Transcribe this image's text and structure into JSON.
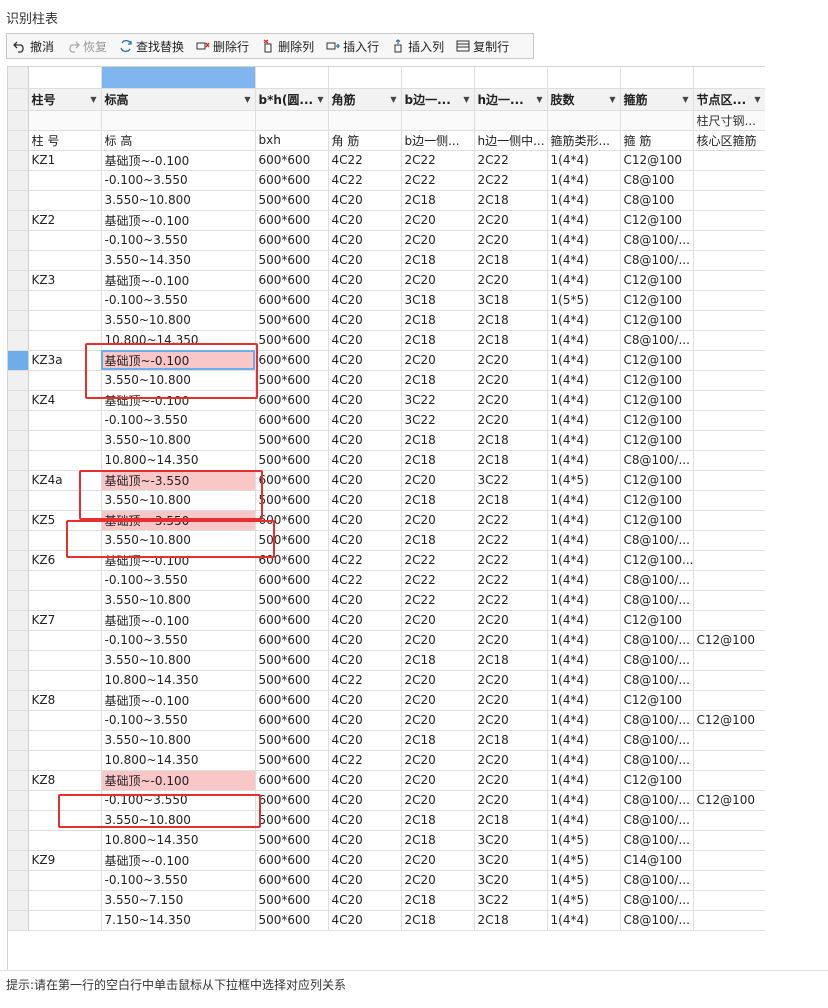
{
  "window": {
    "title": "识别柱表"
  },
  "toolbar": {
    "undo": "撤消",
    "redo": "恢复",
    "find_replace": "查找替换",
    "delete_row": "删除行",
    "delete_col": "删除列",
    "insert_row": "插入行",
    "insert_col": "插入列",
    "copy_row": "复制行"
  },
  "columns": {
    "headers": [
      "柱号",
      "标高",
      "b*h(圆...",
      "角筋",
      "b边一...",
      "h边一...",
      "肢数",
      "箍筋",
      "节点区..."
    ],
    "sub_header": [
      "",
      "",
      "",
      "",
      "",
      "",
      "",
      "",
      "柱尺寸钢..."
    ],
    "source_header": [
      "柱 号",
      "标 高",
      "bxh",
      "角 筋",
      "b边一侧...",
      "h边一侧中...",
      "箍筋类形...",
      "箍 筋",
      "核心区箍筋"
    ]
  },
  "rows": [
    [
      "KZ1",
      "基础顶~-0.100",
      "600*600",
      "4C22",
      "2C22",
      "2C22",
      "1(4*4)",
      "C12@100",
      ""
    ],
    [
      "",
      "-0.100~3.550",
      "600*600",
      "4C22",
      "2C22",
      "2C22",
      "1(4*4)",
      "C8@100",
      ""
    ],
    [
      "",
      "3.550~10.800",
      "500*600",
      "4C20",
      "2C18",
      "2C18",
      "1(4*4)",
      "C8@100",
      ""
    ],
    [
      "KZ2",
      "基础顶~-0.100",
      "600*600",
      "4C20",
      "2C20",
      "2C20",
      "1(4*4)",
      "C12@100",
      ""
    ],
    [
      "",
      "-0.100~3.550",
      "600*600",
      "4C20",
      "2C20",
      "2C20",
      "1(4*4)",
      "C8@100/...",
      ""
    ],
    [
      "",
      "3.550~14.350",
      "500*600",
      "4C20",
      "2C18",
      "2C18",
      "1(4*4)",
      "C8@100/...",
      ""
    ],
    [
      "KZ3",
      "基础顶~-0.100",
      "600*600",
      "4C20",
      "2C20",
      "2C20",
      "1(4*4)",
      "C12@100",
      ""
    ],
    [
      "",
      "-0.100~3.550",
      "600*600",
      "4C20",
      "3C18",
      "3C18",
      "1(5*5)",
      "C12@100",
      ""
    ],
    [
      "",
      "3.550~10.800",
      "500*600",
      "4C20",
      "2C18",
      "2C18",
      "1(4*4)",
      "C12@100",
      ""
    ],
    [
      "",
      "10.800~14.350",
      "500*600",
      "4C20",
      "2C18",
      "2C18",
      "1(4*4)",
      "C8@100/...",
      ""
    ],
    [
      "KZ3a",
      "基础顶~-0.100",
      "600*600",
      "4C20",
      "2C20",
      "2C20",
      "1(4*4)",
      "C12@100",
      ""
    ],
    [
      "",
      "3.550~10.800",
      "500*600",
      "4C20",
      "2C18",
      "2C20",
      "1(4*4)",
      "C12@100",
      ""
    ],
    [
      "KZ4",
      "基础顶~-0.100",
      "600*600",
      "4C20",
      "3C22",
      "2C20",
      "1(4*4)",
      "C12@100",
      ""
    ],
    [
      "",
      "-0.100~3.550",
      "600*600",
      "4C20",
      "3C22",
      "2C20",
      "1(4*4)",
      "C12@100",
      ""
    ],
    [
      "",
      "3.550~10.800",
      "500*600",
      "4C20",
      "2C18",
      "2C18",
      "1(4*4)",
      "C12@100",
      ""
    ],
    [
      "",
      "10.800~14.350",
      "500*600",
      "4C20",
      "2C18",
      "2C18",
      "1(4*4)",
      "C8@100/...",
      ""
    ],
    [
      "KZ4a",
      "基础顶~-3.550",
      "600*600",
      "4C20",
      "2C20",
      "3C22",
      "1(4*5)",
      "C12@100",
      ""
    ],
    [
      "",
      "3.550~10.800",
      "500*600",
      "4C20",
      "2C18",
      "2C18",
      "1(4*4)",
      "C12@100",
      ""
    ],
    [
      "KZ5",
      "基础顶~-3.550",
      "600*600",
      "4C20",
      "2C20",
      "2C22",
      "1(4*4)",
      "C12@100",
      ""
    ],
    [
      "",
      "3.550~10.800",
      "500*600",
      "4C20",
      "2C18",
      "2C22",
      "1(4*4)",
      "C8@100/...",
      ""
    ],
    [
      "KZ6",
      "基础顶~-0.100",
      "600*600",
      "4C22",
      "2C22",
      "2C22",
      "1(4*4)",
      "C12@100...",
      ""
    ],
    [
      "",
      "-0.100~3.550",
      "600*600",
      "4C22",
      "2C22",
      "2C22",
      "1(4*4)",
      "C8@100/...",
      ""
    ],
    [
      "",
      "3.550~10.800",
      "500*600",
      "4C20",
      "2C22",
      "2C22",
      "1(4*4)",
      "C8@100/...",
      ""
    ],
    [
      "KZ7",
      "基础顶~-0.100",
      "600*600",
      "4C20",
      "2C20",
      "2C20",
      "1(4*4)",
      "C12@100",
      ""
    ],
    [
      "",
      "-0.100~3.550",
      "600*600",
      "4C20",
      "2C20",
      "2C20",
      "1(4*4)",
      "C8@100/...",
      "C12@100"
    ],
    [
      "",
      "3.550~10.800",
      "500*600",
      "4C20",
      "2C18",
      "2C18",
      "1(4*4)",
      "C8@100/...",
      ""
    ],
    [
      "",
      "10.800~14.350",
      "500*600",
      "4C22",
      "2C20",
      "2C20",
      "1(4*4)",
      "C8@100/...",
      ""
    ],
    [
      "KZ8",
      "基础顶~-0.100",
      "600*600",
      "4C20",
      "2C20",
      "2C20",
      "1(4*4)",
      "C12@100",
      ""
    ],
    [
      "",
      "-0.100~3.550",
      "600*600",
      "4C20",
      "2C20",
      "2C20",
      "1(4*4)",
      "C8@100/...",
      "C12@100"
    ],
    [
      "",
      "3.550~10.800",
      "500*600",
      "4C20",
      "2C18",
      "2C18",
      "1(4*4)",
      "C8@100/...",
      ""
    ],
    [
      "",
      "10.800~14.350",
      "500*600",
      "4C22",
      "2C20",
      "2C20",
      "1(4*4)",
      "C8@100/...",
      ""
    ],
    [
      "KZ8",
      "基础顶~-0.100",
      "600*600",
      "4C20",
      "2C20",
      "2C20",
      "1(4*4)",
      "C12@100",
      ""
    ],
    [
      "",
      "-0.100~3.550",
      "600*600",
      "4C20",
      "2C20",
      "2C20",
      "1(4*4)",
      "C8@100/...",
      "C12@100"
    ],
    [
      "",
      "3.550~10.800",
      "500*600",
      "4C20",
      "2C18",
      "2C18",
      "1(4*4)",
      "C8@100/...",
      ""
    ],
    [
      "",
      "10.800~14.350",
      "500*600",
      "4C20",
      "2C18",
      "3C20",
      "1(4*5)",
      "C8@100/...",
      ""
    ],
    [
      "KZ9",
      "基础顶~-0.100",
      "600*600",
      "4C20",
      "2C20",
      "3C20",
      "1(4*5)",
      "C14@100",
      ""
    ],
    [
      "",
      "-0.100~3.550",
      "600*600",
      "4C20",
      "2C20",
      "3C20",
      "1(4*5)",
      "C8@100/...",
      ""
    ],
    [
      "",
      "3.550~7.150",
      "500*600",
      "4C20",
      "2C18",
      "3C22",
      "1(4*5)",
      "C8@100/...",
      ""
    ],
    [
      "",
      "7.150~14.350",
      "500*600",
      "4C20",
      "2C18",
      "2C18",
      "1(4*4)",
      "C8@100/...",
      ""
    ]
  ],
  "status": {
    "hint": "提示:请在第一行的空白行中单击鼠标从下拉框中选择对应列关系"
  },
  "colors": {
    "highlight": "#f9c7c7",
    "selection": "#7fb6f0",
    "annotation": "#e53030"
  }
}
